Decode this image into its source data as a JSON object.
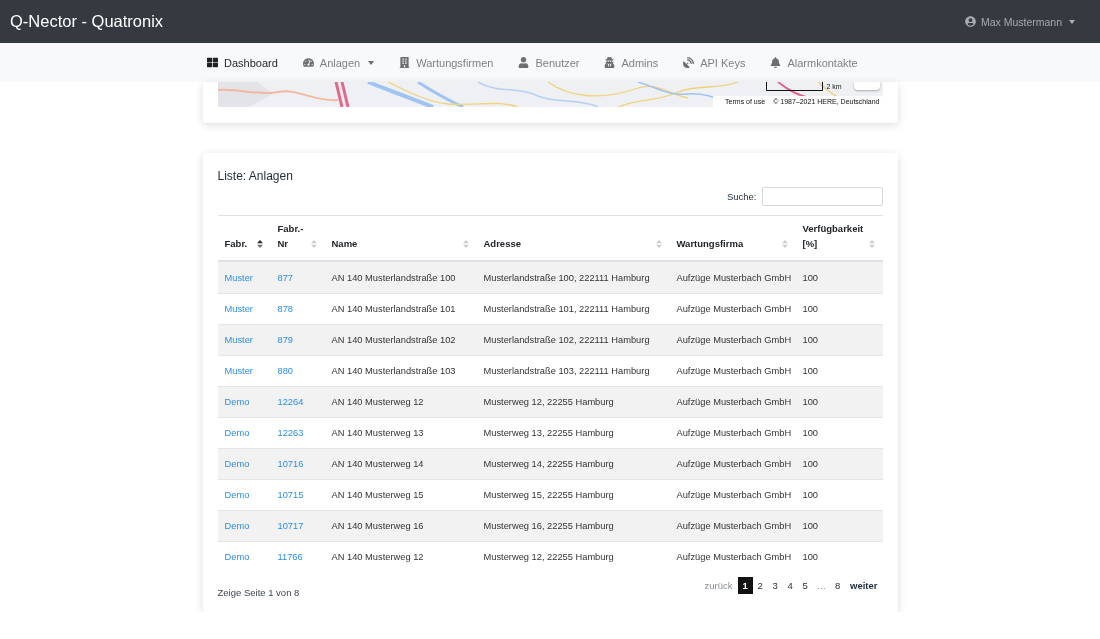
{
  "navbar": {
    "brand": "Q-Nector - Quatronix",
    "user": {
      "name": "Max Mustermann",
      "dropdown": true
    }
  },
  "menu": [
    {
      "label": "Dashboard",
      "selected": true,
      "dropdown": false
    },
    {
      "label": "Anlagen",
      "selected": false,
      "dropdown": true
    },
    {
      "label": "Wartungsfirmen",
      "selected": false,
      "dropdown": false
    },
    {
      "label": "Benutzer",
      "selected": false,
      "dropdown": false
    },
    {
      "label": "Admins",
      "selected": false,
      "dropdown": false
    },
    {
      "label": "API Keys",
      "selected": false,
      "dropdown": false
    },
    {
      "label": "Alarmkontakte",
      "selected": false,
      "dropdown": false
    }
  ],
  "map": {
    "scale": "2 km",
    "terms": "Terms of use",
    "copyright": "© 1987–2021 HERE, Deutschland"
  },
  "list": {
    "title": "Liste: Anlagen",
    "search_label": "Suche:",
    "columns": [
      {
        "label": "Fabr.",
        "sorted": true
      },
      {
        "label": "Fabr.-Nr",
        "sorted": false
      },
      {
        "label": "Name",
        "sorted": false
      },
      {
        "label": "Adresse",
        "sorted": false
      },
      {
        "label": "Wartungsfirma",
        "sorted": false
      },
      {
        "label": "Verfügbarkeit [%]",
        "sorted": false
      }
    ],
    "rows": [
      {
        "manufacturer": "Muster",
        "number": "877",
        "name": "AN 140 Musterlandstraße 100",
        "address": "Musterlandstraße 100, 222111 Hamburg",
        "company": "Aufzüge Musterbach GmbH",
        "availability": "100"
      },
      {
        "manufacturer": "Muster",
        "number": "878",
        "name": "AN 140 Musterlandstraße 101",
        "address": "Musterlandstraße 101, 222111 Hamburg",
        "company": "Aufzüge Musterbach GmbH",
        "availability": "100"
      },
      {
        "manufacturer": "Muster",
        "number": "879",
        "name": "AN 140 Musterlandstraße 102",
        "address": "Musterlandstraße 102, 222111 Hamburg",
        "company": "Aufzüge Musterbach GmbH",
        "availability": "100"
      },
      {
        "manufacturer": "Muster",
        "number": "880",
        "name": "AN 140 Musterlandstraße 103",
        "address": "Musterlandstraße 103, 222111 Hamburg",
        "company": "Aufzüge Musterbach GmbH",
        "availability": "100"
      },
      {
        "manufacturer": "Demo",
        "number": "12264",
        "name": "AN 140 Musterweg 12",
        "address": "Musterweg 12, 22255 Hamburg",
        "company": "Aufzüge Musterbach GmbH",
        "availability": "100"
      },
      {
        "manufacturer": "Demo",
        "number": "12263",
        "name": "AN 140 Musterweg 13",
        "address": "Musterweg 13, 22255 Hamburg",
        "company": "Aufzüge Musterbach GmbH",
        "availability": "100"
      },
      {
        "manufacturer": "Demo",
        "number": "10716",
        "name": "AN 140 Musterweg 14",
        "address": "Musterweg 14, 22255 Hamburg",
        "company": "Aufzüge Musterbach GmbH",
        "availability": "100"
      },
      {
        "manufacturer": "Demo",
        "number": "10715",
        "name": "AN 140 Musterweg 15",
        "address": "Musterweg 15, 22255 Hamburg",
        "company": "Aufzüge Musterbach GmbH",
        "availability": "100"
      },
      {
        "manufacturer": "Demo",
        "number": "10717",
        "name": "AN 140 Musterweg 16",
        "address": "Musterweg 16, 22255 Hamburg",
        "company": "Aufzüge Musterbach GmbH",
        "availability": "100"
      },
      {
        "manufacturer": "Demo",
        "number": "11766",
        "name": "AN 140 Musterweg 12",
        "address": "Musterweg 12, 22255 Hamburg",
        "company": "Aufzüge Musterbach GmbH",
        "availability": "100"
      }
    ],
    "info": "Zeige Seite 1 von 8",
    "pagination": {
      "prev": {
        "label": "zurück",
        "disabled": true
      },
      "pages": [
        {
          "kind": "page",
          "label": "1",
          "selected": true
        },
        {
          "kind": "page",
          "label": "2",
          "selected": false
        },
        {
          "kind": "page",
          "label": "3",
          "selected": false
        },
        {
          "kind": "page",
          "label": "4",
          "selected": false
        },
        {
          "kind": "page",
          "label": "5",
          "selected": false
        },
        {
          "kind": "ellipsis",
          "label": "…"
        },
        {
          "kind": "page",
          "label": "8",
          "selected": false
        }
      ],
      "next": {
        "label": "weiter",
        "disabled": false
      }
    }
  }
}
